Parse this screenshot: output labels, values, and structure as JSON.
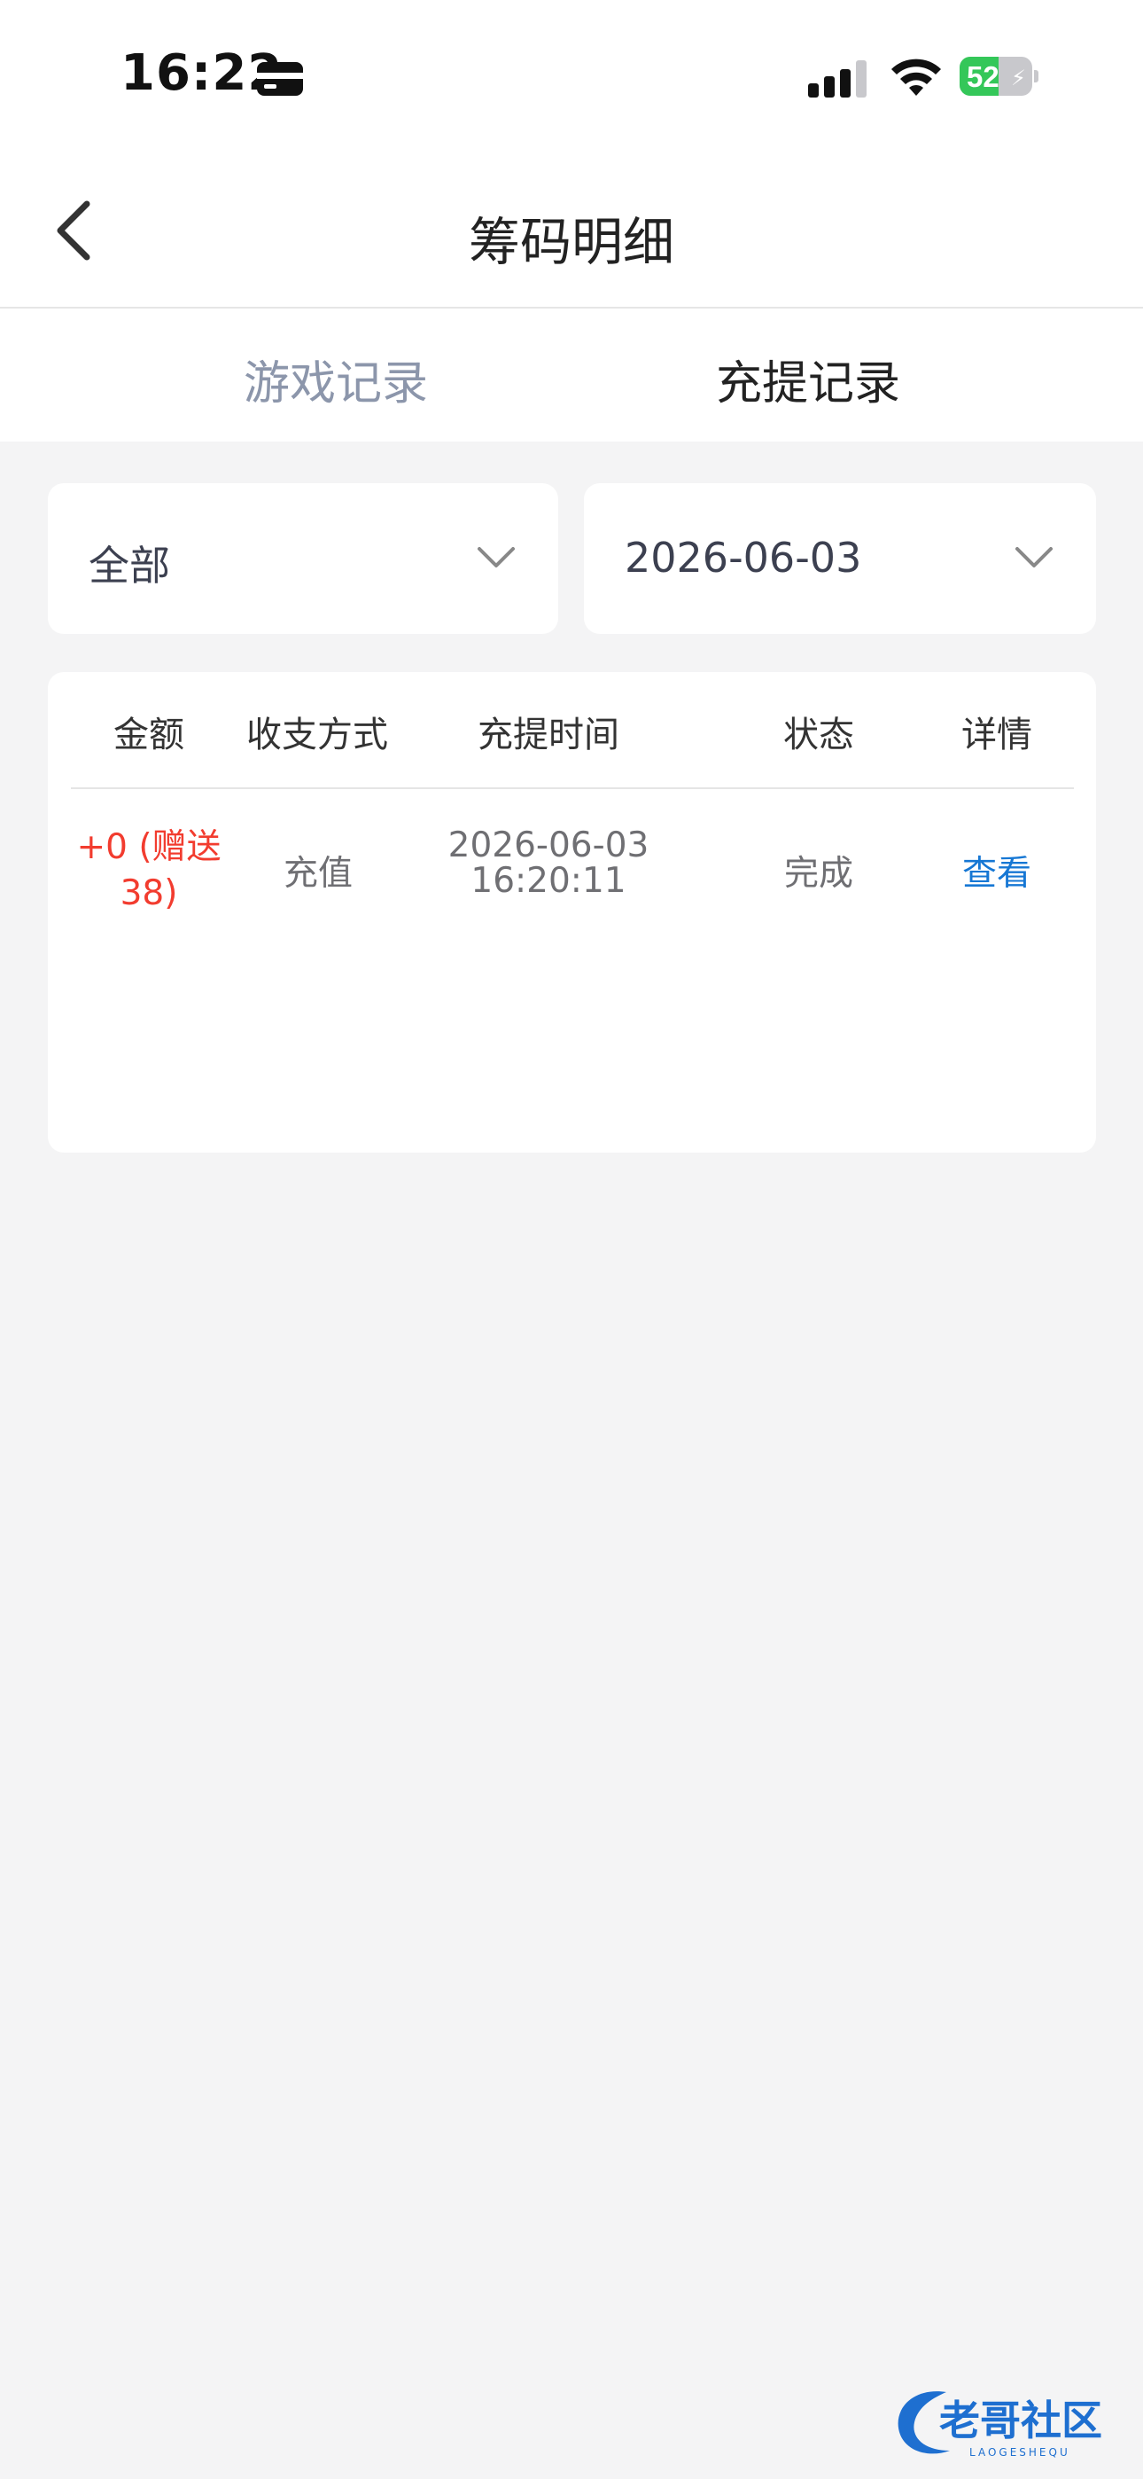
{
  "status_bar": {
    "time": "16:22",
    "battery": "52"
  },
  "nav": {
    "title": "筹码明细"
  },
  "tabs": [
    {
      "label": "游戏记录",
      "active": false
    },
    {
      "label": "充提记录",
      "active": true
    }
  ],
  "filters": {
    "type": {
      "value": "全部"
    },
    "date": {
      "value": "2026-06-03"
    }
  },
  "table": {
    "headers": [
      "金额",
      "收支方式",
      "充提时间",
      "状态",
      "详情"
    ],
    "rows": [
      {
        "amount_line1": "+0 (赠送",
        "amount_line2": "38)",
        "method": "充值",
        "date": "2026-06-03",
        "time": "16:20:11",
        "status": "完成",
        "detail": "查看"
      }
    ]
  },
  "watermark": {
    "text": "老哥社区",
    "subtext": "LAOGESHEQU"
  },
  "colors": {
    "red": "#f23c2f",
    "link": "#1677d4",
    "battery": "#34c759",
    "inactive_tab": "#8c96ab"
  }
}
